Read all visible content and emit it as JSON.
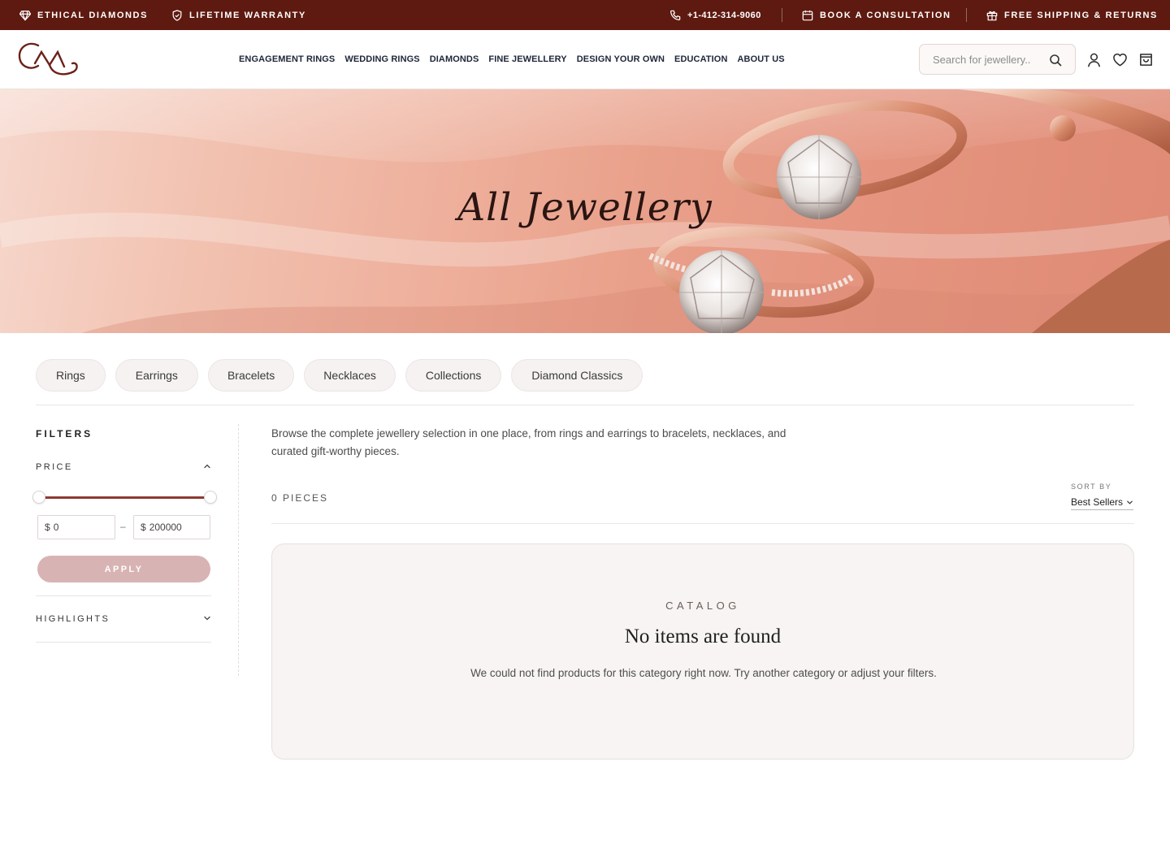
{
  "topbar": {
    "ethical": "ETHICAL DIAMONDS",
    "warranty": "LIFETIME WARRANTY",
    "phone": "+1-412-314-9060",
    "consultation": "BOOK A CONSULTATION",
    "shipping": "FREE SHIPPING & RETURNS",
    "background": "#5e1a10"
  },
  "header": {
    "nav": [
      "ENGAGEMENT RINGS",
      "WEDDING RINGS",
      "DIAMONDS",
      "FINE JEWELLERY",
      "DESIGN YOUR OWN",
      "EDUCATION",
      "ABOUT US"
    ],
    "search_placeholder": "Search for jewellery..",
    "icons": [
      "search-icon",
      "account-icon",
      "heart-icon",
      "cart-icon"
    ]
  },
  "hero": {
    "title": "All Jewellery"
  },
  "categories": [
    "Rings",
    "Earrings",
    "Bracelets",
    "Necklaces",
    "Collections",
    "Diamond Classics"
  ],
  "filters": {
    "title": "FILTERS",
    "price": {
      "label": "PRICE",
      "currency": "$",
      "min": "0",
      "max": "200000",
      "apply": "APPLY"
    },
    "highlights": "HIGHLIGHTS"
  },
  "listing": {
    "description": "Browse the complete jewellery selection in one place, from rings and earrings to bracelets, necklaces, and curated gift-worthy pieces.",
    "count": "0 PIECES",
    "sort_label": "SORT BY",
    "sort_value": "Best Sellers"
  },
  "empty_state": {
    "kicker": "CATALOG",
    "headline": "No items are found",
    "message": "We could not find products for this category right now. Try another category or adjust your filters."
  },
  "colors": {
    "brand": "#5e1a10",
    "accent": "#8e3a33",
    "apply_button": "#d8b3b3"
  }
}
